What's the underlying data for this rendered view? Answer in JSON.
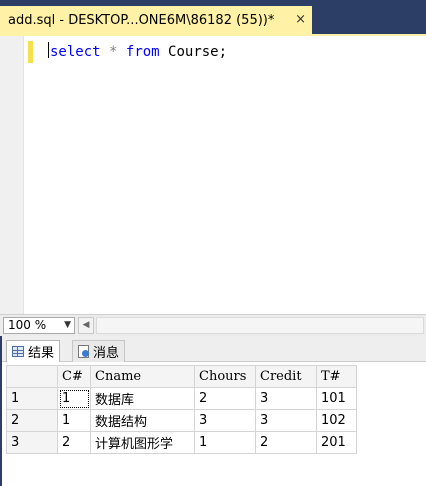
{
  "tab": {
    "title": "add.sql - DESKTOP...ONE6M\\86182 (55))*",
    "close": "×"
  },
  "editor": {
    "code": {
      "select": "select",
      "star": "*",
      "from": "from",
      "rest": " Course;"
    }
  },
  "statusbar": {
    "zoom": "100 %",
    "zoom_arrow": "▼",
    "scroll_left": "◀"
  },
  "result_tabs": {
    "results_label": "结果",
    "messages_label": "消息"
  },
  "results": {
    "columns": [
      "C#",
      "Cname",
      "Chours",
      "Credit",
      "T#"
    ],
    "rows": [
      {
        "num": "1",
        "cells": [
          "1",
          "数据库",
          "2",
          "3",
          "101"
        ]
      },
      {
        "num": "2",
        "cells": [
          "1",
          "数据结构",
          "3",
          "3",
          "102"
        ]
      },
      {
        "num": "3",
        "cells": [
          "2",
          "计算机图形学",
          "1",
          "2",
          "201"
        ]
      }
    ]
  },
  "colors": {
    "chrome": "#2c3e66",
    "active_tab": "#fff1a5",
    "keyword": "#0000ff"
  }
}
